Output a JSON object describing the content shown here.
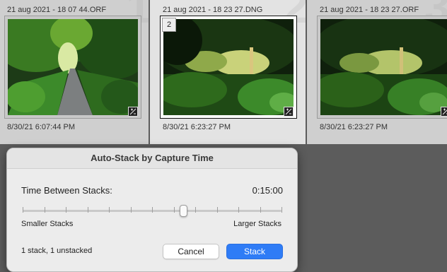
{
  "grid": {
    "cells": [
      {
        "index": "1",
        "filename": "21 aug 2021 - 18 07 44.ORF",
        "date": "8/30/21 6:07:44 PM",
        "stack_count": ""
      },
      {
        "index": "2",
        "filename": "21 aug 2021 - 18 23 27.DNG",
        "date": "8/30/21 6:23:27 PM",
        "stack_count": "2"
      },
      {
        "index": "3",
        "filename": "21 aug 2021 - 18 23 27.ORF",
        "date": "8/30/21 6:23:27 PM",
        "stack_count": ""
      }
    ]
  },
  "dialog": {
    "title": "Auto-Stack by Capture Time",
    "time_label": "Time Between Stacks:",
    "time_value": "0:15:00",
    "slider_value_fraction": 0.62,
    "smaller_label": "Smaller Stacks",
    "larger_label": "Larger Stacks",
    "status": "1 stack, 1 unstacked",
    "cancel_label": "Cancel",
    "stack_label": "Stack"
  },
  "colors": {
    "accent": "#2f7cf6",
    "cell_bg": "#cfcfcf",
    "cell_selected_bg": "#e3e3e3",
    "background": "#5c5c5c"
  },
  "icons": {
    "edit_badge": "develop-adjustment-icon",
    "stack_badge": "stack-count-badge"
  }
}
